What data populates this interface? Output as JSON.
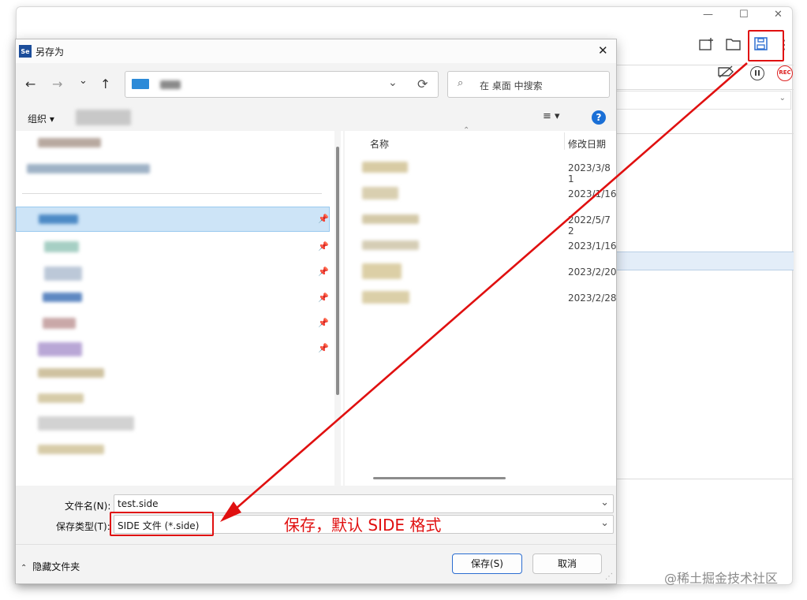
{
  "background_app": {
    "toolbar_icons": [
      "new-window-icon",
      "open-folder-icon",
      "save-icon",
      "more-icon"
    ],
    "sub_icons": [
      "disable-breakpoints-icon",
      "pause-icon",
      "record-icon"
    ],
    "record_label": "REC",
    "window_controls": [
      "—",
      "☐",
      "✕"
    ],
    "more_glyph": "⋮"
  },
  "dialog": {
    "title": "另存为",
    "app_icon_text": "Se",
    "close_glyph": "✕",
    "nav": {
      "back": "←",
      "forward": "→",
      "history": "⌄",
      "up": "↑",
      "refresh": "⟳"
    },
    "search_placeholder": "在 桌面 中搜索",
    "organize_label": "组织 ▾",
    "view_glyph": "≡ ▾",
    "help_glyph": "?",
    "columns": {
      "name": "名称",
      "modified": "修改日期"
    },
    "files": [
      {
        "date": "2023/3/8 1"
      },
      {
        "date": "2023/1/16"
      },
      {
        "date": "2022/5/7 2"
      },
      {
        "date": "2023/1/16"
      },
      {
        "date": "2023/2/20"
      },
      {
        "date": "2023/2/28"
      }
    ],
    "filename_label": "文件名(N):",
    "filename_value": "test.side",
    "filetype_label": "保存类型(T):",
    "filetype_value": "SIDE 文件 (*.side)",
    "hide_folders_label": "隐藏文件夹",
    "save_button": "保存(S)",
    "cancel_button": "取消"
  },
  "annotation": {
    "text": "保存，默认 SIDE 格式",
    "color": "#e01010"
  },
  "watermark": "@稀土掘金技术社区"
}
